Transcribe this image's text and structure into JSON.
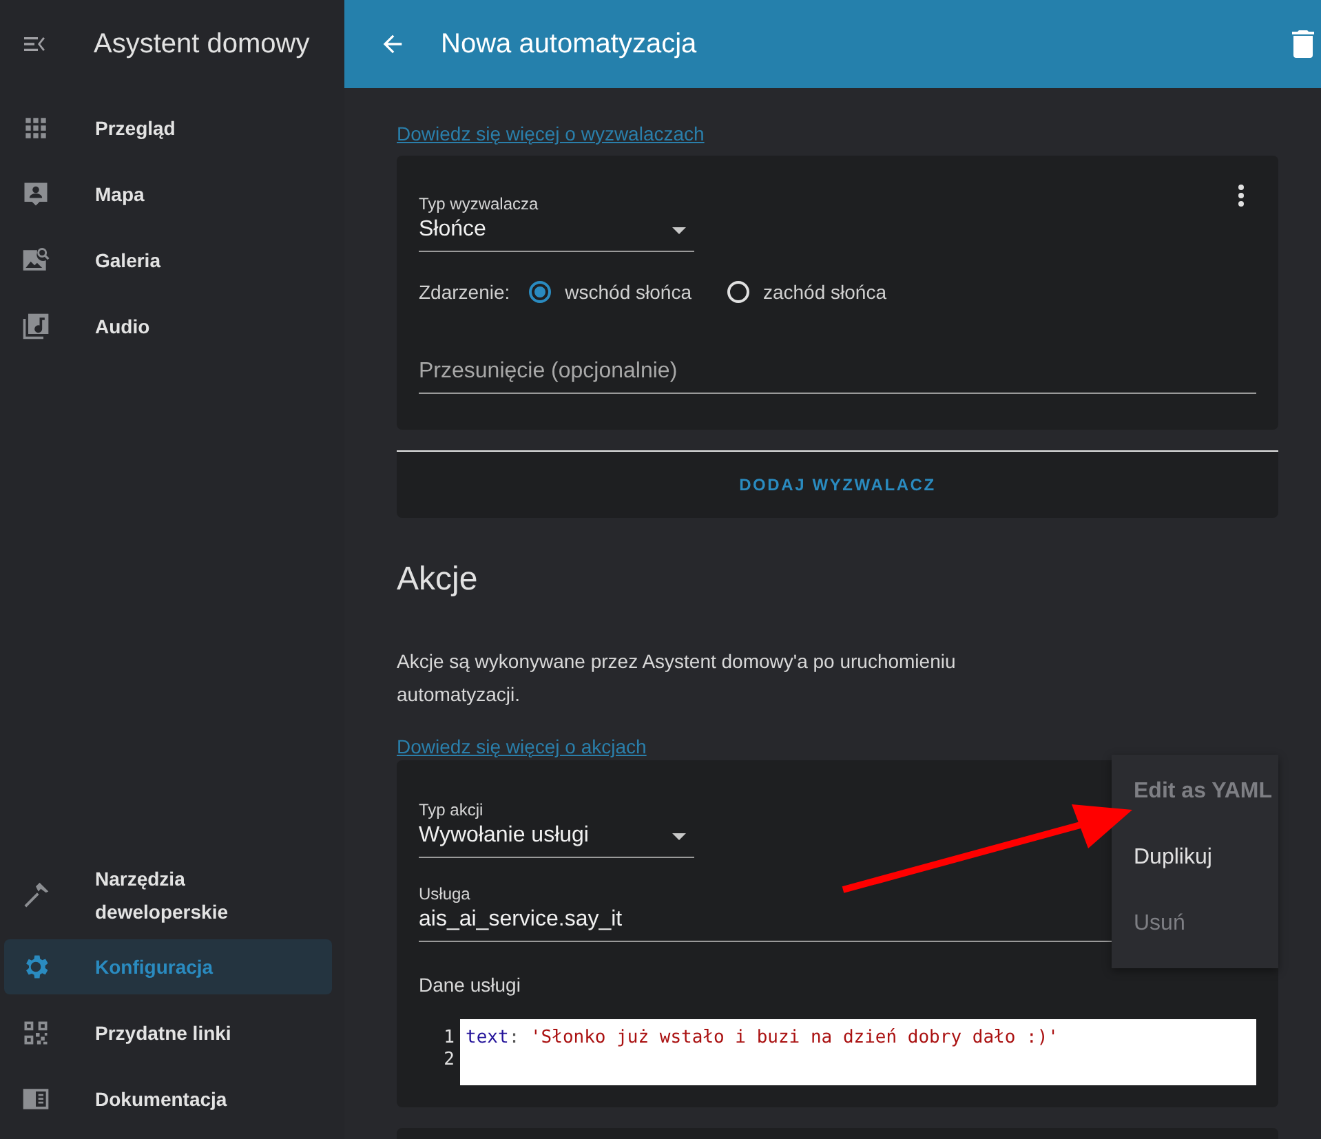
{
  "sidebar": {
    "title": "Asystent domowy",
    "items": [
      {
        "label": "Przegląd",
        "selected": false
      },
      {
        "label": "Mapa",
        "selected": false
      },
      {
        "label": "Galeria",
        "selected": false
      },
      {
        "label": "Audio",
        "selected": false
      }
    ],
    "bottom_items": [
      {
        "label": "Narzędzia deweloperskie",
        "selected": false
      },
      {
        "label": "Konfiguracja",
        "selected": true
      },
      {
        "label": "Przydatne linki",
        "selected": false
      },
      {
        "label": "Dokumentacja",
        "selected": false
      }
    ]
  },
  "toolbar": {
    "title": "Nowa automatyzacja"
  },
  "triggers": {
    "link": "Dowiedz się więcej o wyzwalaczach",
    "card": {
      "type_label": "Typ wyzwalacza",
      "type_value": "Słońce",
      "event_label": "Zdarzenie:",
      "radios": [
        {
          "label": "wschód słońca",
          "selected": true
        },
        {
          "label": "zachód słońca",
          "selected": false
        }
      ],
      "offset_placeholder": "Przesunięcie (opcjonalnie)"
    },
    "add_button": "DODAJ WYZWALACZ"
  },
  "actions": {
    "heading": "Akcje",
    "description": "Akcje są wykonywane przez Asystent domowy'a po uruchomieniu automatyzacji.",
    "link": "Dowiedz się więcej o akcjach",
    "card": {
      "type_label": "Typ akcji",
      "type_value": "Wywołanie usługi",
      "service_label": "Usługa",
      "service_value": "ais_ai_service.say_it",
      "data_label": "Dane usługi",
      "code_lines": [
        {
          "number": "1",
          "key": "text",
          "separator": ":",
          "value": "'Słonko już wstało i buzi na dzień dobry dało :)'"
        },
        {
          "number": "2"
        }
      ]
    }
  },
  "menu": {
    "items": [
      {
        "label": "Edit as YAML",
        "disabled": true,
        "bold": true
      },
      {
        "label": "Duplikuj",
        "disabled": false,
        "bold": false
      },
      {
        "label": "Usuń",
        "disabled": true,
        "bold": false
      }
    ]
  }
}
